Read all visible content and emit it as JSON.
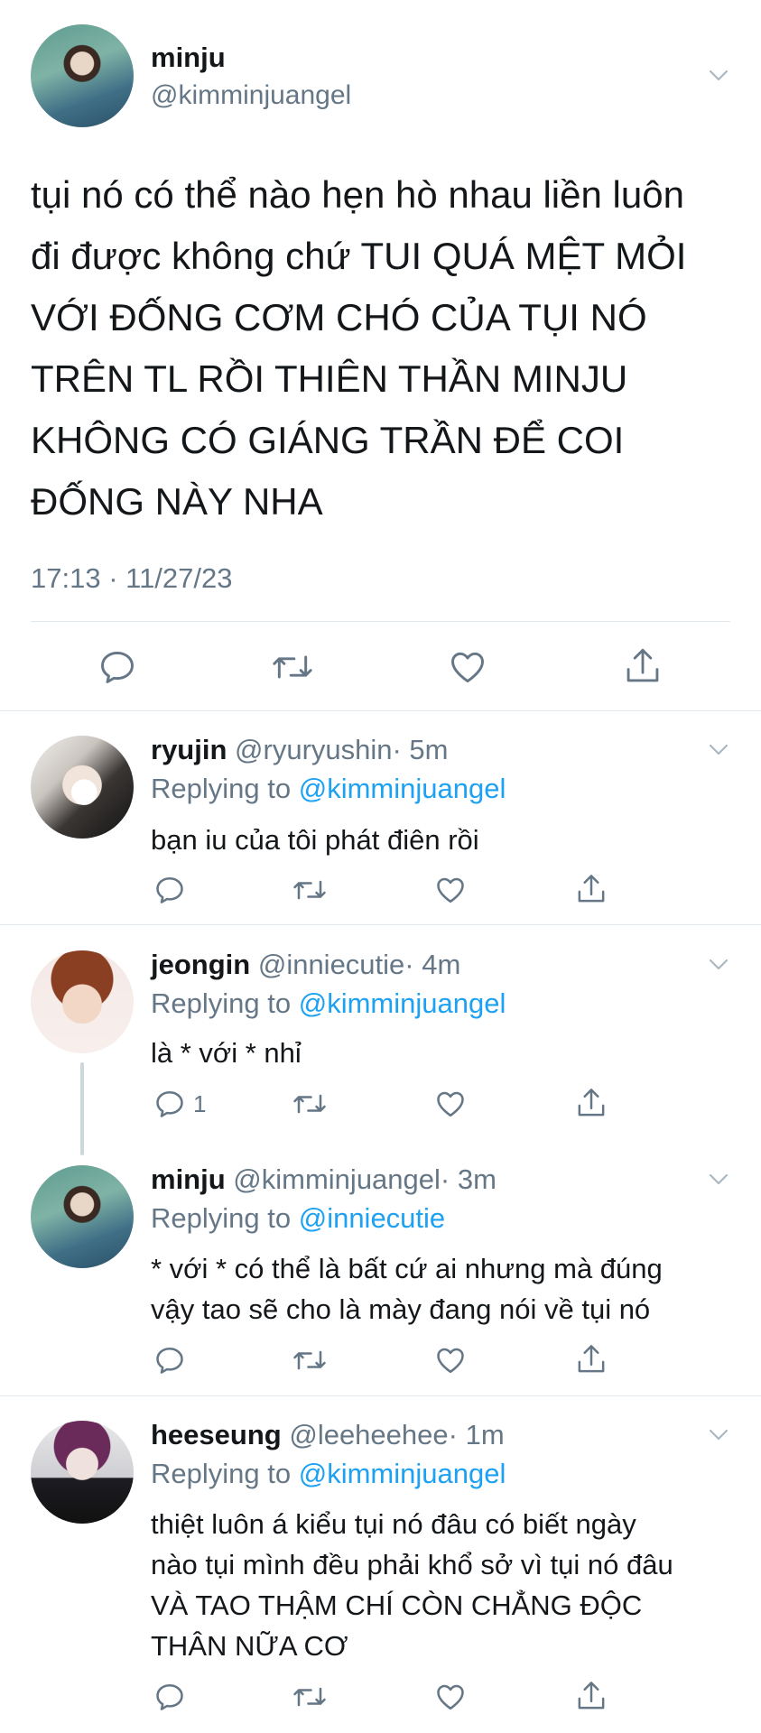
{
  "main_tweet": {
    "name": "minju",
    "handle": "@kimminjuangel",
    "lines": [
      "tụi nó có thể nào hẹn hò nhau liền luôn",
      "đi được không chứ TUI QUÁ MỆT MỎI",
      "VỚI ĐỐNG CƠM CHÓ CỦA TỤI NÓ",
      "TRÊN TL RỒI THIÊN THẦN MINJU",
      "KHÔNG CÓ GIÁNG TRẦN ĐỂ COI",
      "ĐỐNG NÀY NHA"
    ],
    "timestamp": "17:13 · 11/27/23"
  },
  "icons": {
    "reply": "reply-icon",
    "retweet": "retweet-icon",
    "like": "heart-icon",
    "share": "share-icon",
    "more": "chevron-down-icon"
  },
  "replies": [
    {
      "name": "ryujin",
      "handle": "@ryuryushin",
      "time": "· 5m",
      "replying_prefix": "Replying to",
      "replying_to": "@kimminjuangel",
      "lines": [
        "bạn iu của tôi phát điên rồi"
      ],
      "reply_count": ""
    },
    {
      "name": "jeongin",
      "handle": "@inniecutie",
      "time": "· 4m",
      "replying_prefix": "Replying to",
      "replying_to": "@kimminjuangel",
      "lines": [
        "là * với * nhỉ"
      ],
      "reply_count": "1"
    },
    {
      "name": "minju",
      "handle": "@kimminjuangel",
      "time": "· 3m",
      "replying_prefix": "Replying to",
      "replying_to": "@inniecutie",
      "lines": [
        "* với * có thể là bất cứ ai nhưng mà đúng",
        "vậy tao sẽ cho là mày đang nói về tụi nó"
      ],
      "reply_count": ""
    },
    {
      "name": "heeseung",
      "handle": "@leeheehee",
      "time": "· 1m",
      "replying_prefix": "Replying to",
      "replying_to": "@kimminjuangel",
      "lines": [
        "thiệt luôn á kiểu tụi nó đâu có biết ngày",
        "nào tụi mình đều phải khổ sở vì tụi nó đâu",
        "VÀ TAO THẬM CHÍ CÒN CHẲNG ĐỘC",
        "THÂN NỮA CƠ"
      ],
      "reply_count": ""
    }
  ]
}
